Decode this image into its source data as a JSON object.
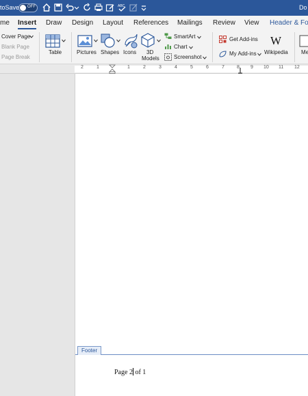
{
  "titlebar": {
    "autosave_label": "toSave",
    "toggle_state": "OFF",
    "doc_title": "Do"
  },
  "tabs": [
    {
      "label": "me"
    },
    {
      "label": "Insert",
      "active": true
    },
    {
      "label": "Draw"
    },
    {
      "label": "Design"
    },
    {
      "label": "Layout"
    },
    {
      "label": "References"
    },
    {
      "label": "Mailings"
    },
    {
      "label": "Review"
    },
    {
      "label": "View"
    },
    {
      "label": "Header & Foo"
    }
  ],
  "ribbon": {
    "cover_page": "Cover Page",
    "blank_page": "Blank Page",
    "page_break": "Page Break",
    "table": "Table",
    "pictures": "Pictures",
    "shapes": "Shapes",
    "icons": "Icons",
    "models_line1": "3D",
    "models_line2": "Models",
    "smartart": "SmartArt",
    "chart": "Chart",
    "screenshot": "Screenshot",
    "get_addins": "Get Add-ins",
    "my_addins": "My Add-ins",
    "wikipedia": "Wikipedia",
    "media": "Me"
  },
  "ruler": {
    "numbers": [
      "2",
      "1",
      "1",
      "2",
      "3",
      "4",
      "5",
      "6",
      "7",
      "8",
      "9",
      "10",
      "11",
      "12"
    ]
  },
  "document": {
    "footer_tab": "Footer",
    "footer_text_before": "Page 2",
    "footer_text_after": "of 1"
  },
  "colors": {
    "accent": "#2b579a"
  }
}
